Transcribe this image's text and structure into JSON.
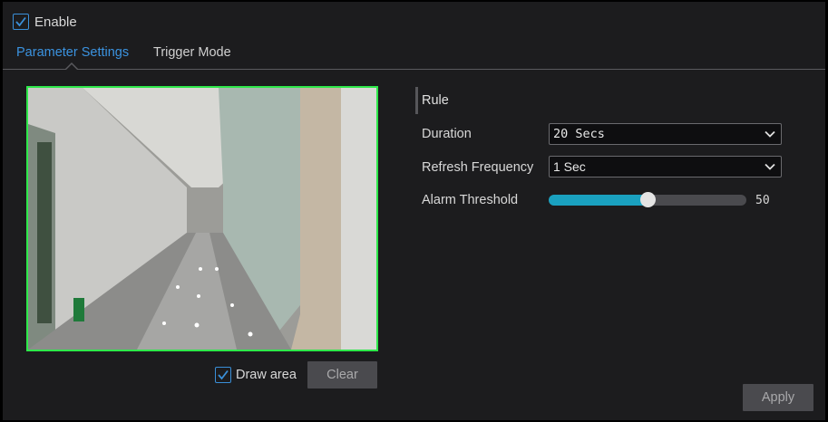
{
  "enable": {
    "label": "Enable",
    "checked": true
  },
  "tabs": [
    {
      "label": "Parameter Settings",
      "active": true
    },
    {
      "label": "Trigger Mode",
      "active": false
    }
  ],
  "preview": {
    "draw_area_label": "Draw area",
    "draw_area_checked": true,
    "clear_label": "Clear",
    "region_color": "#2ee84a"
  },
  "rule": {
    "title": "Rule",
    "duration": {
      "label": "Duration",
      "value": "20 Secs"
    },
    "refresh": {
      "label": "Refresh Frequency",
      "value": "1 Sec"
    },
    "threshold": {
      "label": "Alarm Threshold",
      "value": "50",
      "fraction": 0.5
    }
  },
  "apply_label": "Apply",
  "colors": {
    "accent": "#3b93e0",
    "slider_fill": "#1aa1c0",
    "checkbox_border": "#3a8fd8"
  }
}
